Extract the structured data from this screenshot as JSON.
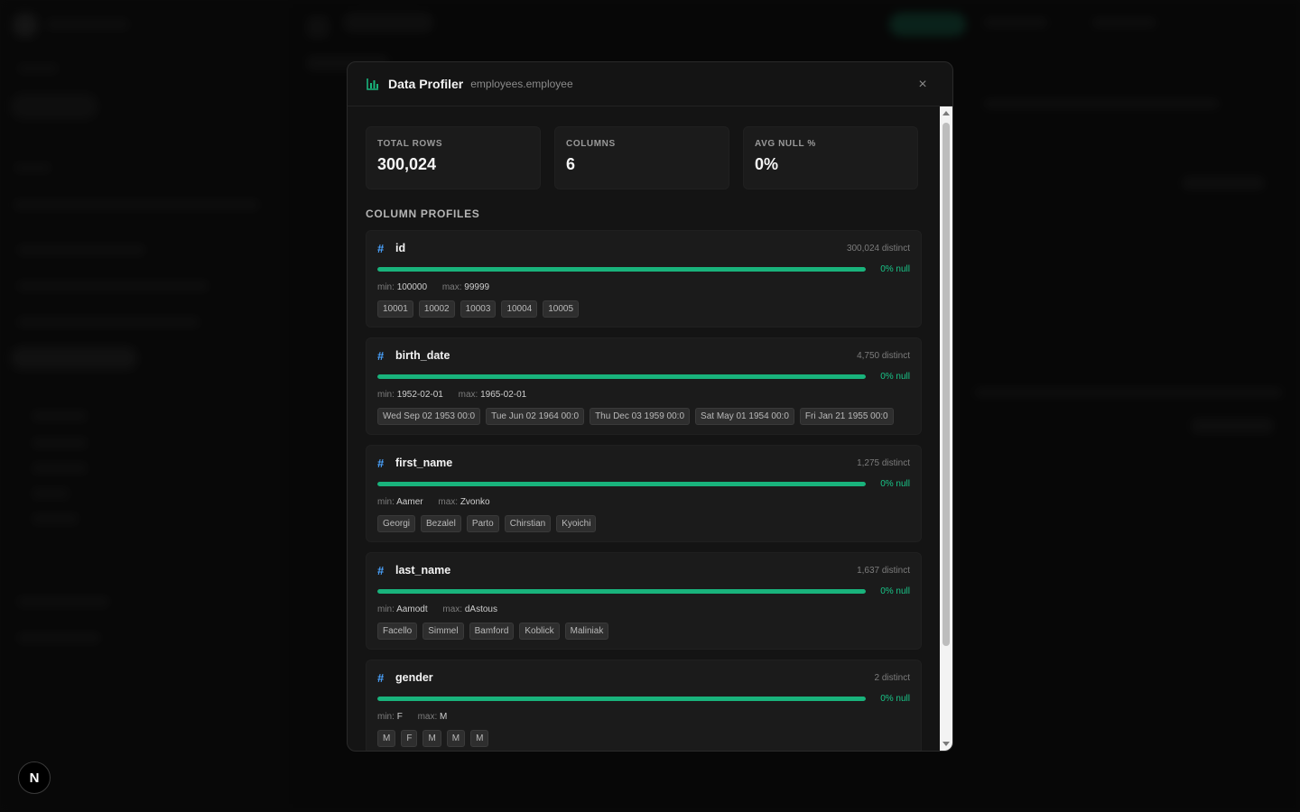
{
  "modal": {
    "title": "Data Profiler",
    "subtitle": "employees.employee",
    "close_label": "×"
  },
  "stats": [
    {
      "label": "TOTAL ROWS",
      "value": "300,024"
    },
    {
      "label": "COLUMNS",
      "value": "6"
    },
    {
      "label": "AVG NULL %",
      "value": "0%"
    }
  ],
  "section_title": "COLUMN PROFILES",
  "columns": [
    {
      "name": "id",
      "distinct": "300,024 distinct",
      "null_text": "0% null",
      "non_null_fraction": 1.0,
      "min_label": "min:",
      "min": "100000",
      "max_label": "max:",
      "max": "99999",
      "samples": [
        "10001",
        "10002",
        "10003",
        "10004",
        "10005"
      ]
    },
    {
      "name": "birth_date",
      "distinct": "4,750 distinct",
      "null_text": "0% null",
      "non_null_fraction": 1.0,
      "min_label": "min:",
      "min": "1952-02-01",
      "max_label": "max:",
      "max": "1965-02-01",
      "samples": [
        "Wed Sep 02 1953 00:0",
        "Tue Jun 02 1964 00:0",
        "Thu Dec 03 1959 00:0",
        "Sat May 01 1954 00:0",
        "Fri Jan 21 1955 00:0"
      ]
    },
    {
      "name": "first_name",
      "distinct": "1,275 distinct",
      "null_text": "0% null",
      "non_null_fraction": 1.0,
      "min_label": "min:",
      "min": "Aamer",
      "max_label": "max:",
      "max": "Zvonko",
      "samples": [
        "Georgi",
        "Bezalel",
        "Parto",
        "Chirstian",
        "Kyoichi"
      ]
    },
    {
      "name": "last_name",
      "distinct": "1,637 distinct",
      "null_text": "0% null",
      "non_null_fraction": 1.0,
      "min_label": "min:",
      "min": "Aamodt",
      "max_label": "max:",
      "max": "dAstous",
      "samples": [
        "Facello",
        "Simmel",
        "Bamford",
        "Koblick",
        "Maliniak"
      ]
    },
    {
      "name": "gender",
      "distinct": "2 distinct",
      "null_text": "0% null",
      "non_null_fraction": 1.0,
      "min_label": "min:",
      "min": "F",
      "max_label": "max:",
      "max": "M",
      "samples": [
        "M",
        "F",
        "M",
        "M",
        "M"
      ]
    }
  ],
  "column_type_icon": "hash-icon",
  "next_badge": "N",
  "colors": {
    "accent": "#19b37c",
    "type_icon": "#4aa3ff"
  }
}
